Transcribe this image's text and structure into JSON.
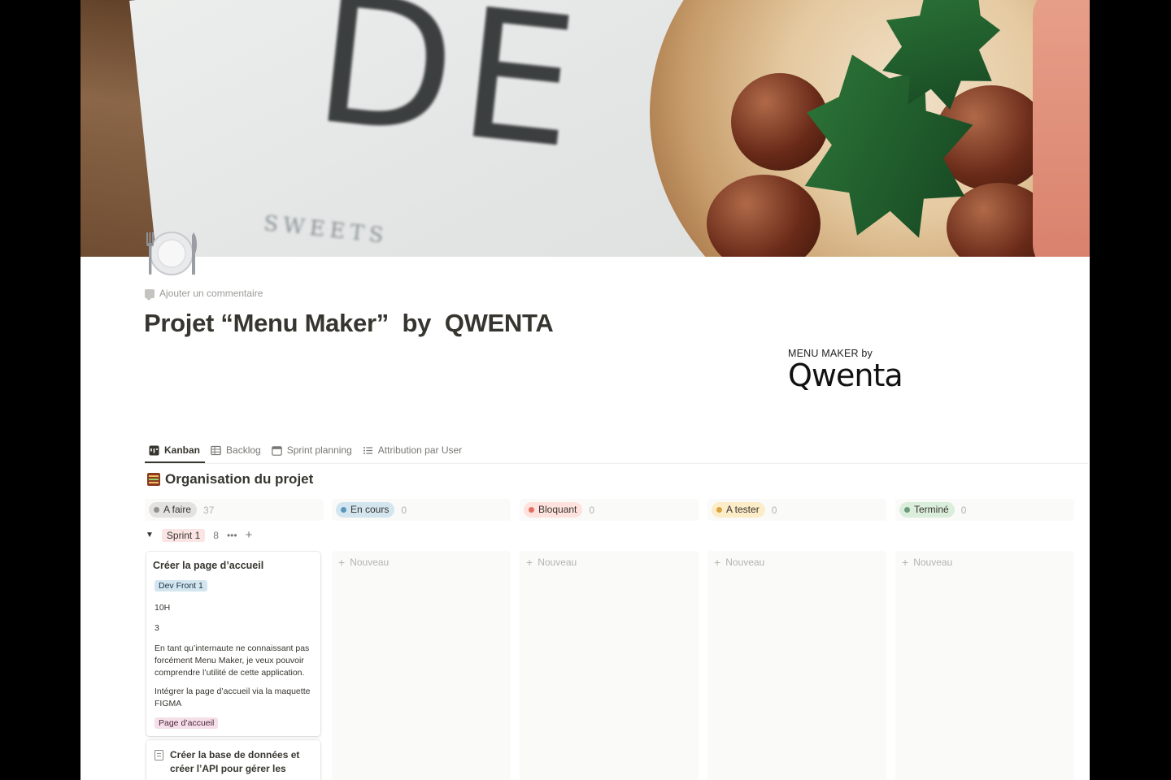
{
  "cover": {
    "letters": "DE",
    "sweets_text": "SWEETS"
  },
  "page_icon": "fork-and-knife-with-plate",
  "add_comment_label": "Ajouter un commentaire",
  "title": "Projet “Menu Maker”  by  QWENTA",
  "logo": {
    "top_text": "MENU MAKER by",
    "wordmark": "Qwenta"
  },
  "tabs": [
    {
      "label": "Kanban",
      "icon": "board-icon",
      "active": true
    },
    {
      "label": "Backlog",
      "icon": "table-icon",
      "active": false
    },
    {
      "label": "Sprint planning",
      "icon": "calendar-icon",
      "active": false
    },
    {
      "label": "Attribution par User",
      "icon": "list-icon",
      "active": false
    }
  ],
  "section_title": "Organisation du projet",
  "columns": [
    {
      "label": "A faire",
      "count": "37",
      "bg": "#e3e2e0",
      "dot": "#91918e"
    },
    {
      "label": "En cours",
      "count": "0",
      "bg": "#d3e5ef",
      "dot": "#5b97bd"
    },
    {
      "label": "Bloquant",
      "count": "0",
      "bg": "#ffe2dd",
      "dot": "#e16f64"
    },
    {
      "label": "A tester",
      "count": "0",
      "bg": "#fdecc8",
      "dot": "#d9a441"
    },
    {
      "label": "Terminé",
      "count": "0",
      "bg": "#dbeddb",
      "dot": "#6c9b7d"
    }
  ],
  "new_label": "Nouveau",
  "group": {
    "label": "Sprint 1",
    "count": "8",
    "more": "•••",
    "add": "+"
  },
  "cards": [
    {
      "title": "Créer la page d’accueil",
      "tag": "Dev Front 1",
      "hours": "10H",
      "points": "3",
      "story": "En tant qu’internaute ne connaissant pas forcément Menu Maker, je veux pouvoir comprendre l’utilité de cette application.",
      "task": "Intégrer la page d’accueil via la maquette FIGMA",
      "label": "Page d’accueil"
    },
    {
      "title": "Créer la base de données et créer l’API pour gérer les menus"
    }
  ]
}
